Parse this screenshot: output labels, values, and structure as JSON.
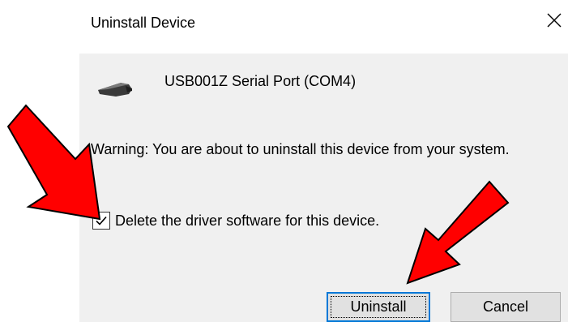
{
  "dialog": {
    "title": "Uninstall Device",
    "close_glyph": "×",
    "device_icon": "usb-serial-port-icon",
    "device_name": "USB001Z Serial Port (COM4)",
    "warning": "Warning: You are about to uninstall this device from your system.",
    "delete_driver_checkbox": {
      "label": "Delete the driver software for this device.",
      "checked": true
    },
    "buttons": {
      "uninstall": "Uninstall",
      "cancel": "Cancel"
    }
  },
  "colors": {
    "panel_background": "#f0f0f0",
    "annotation_arrow": "#ff0000",
    "focus_border": "#0078d7"
  }
}
